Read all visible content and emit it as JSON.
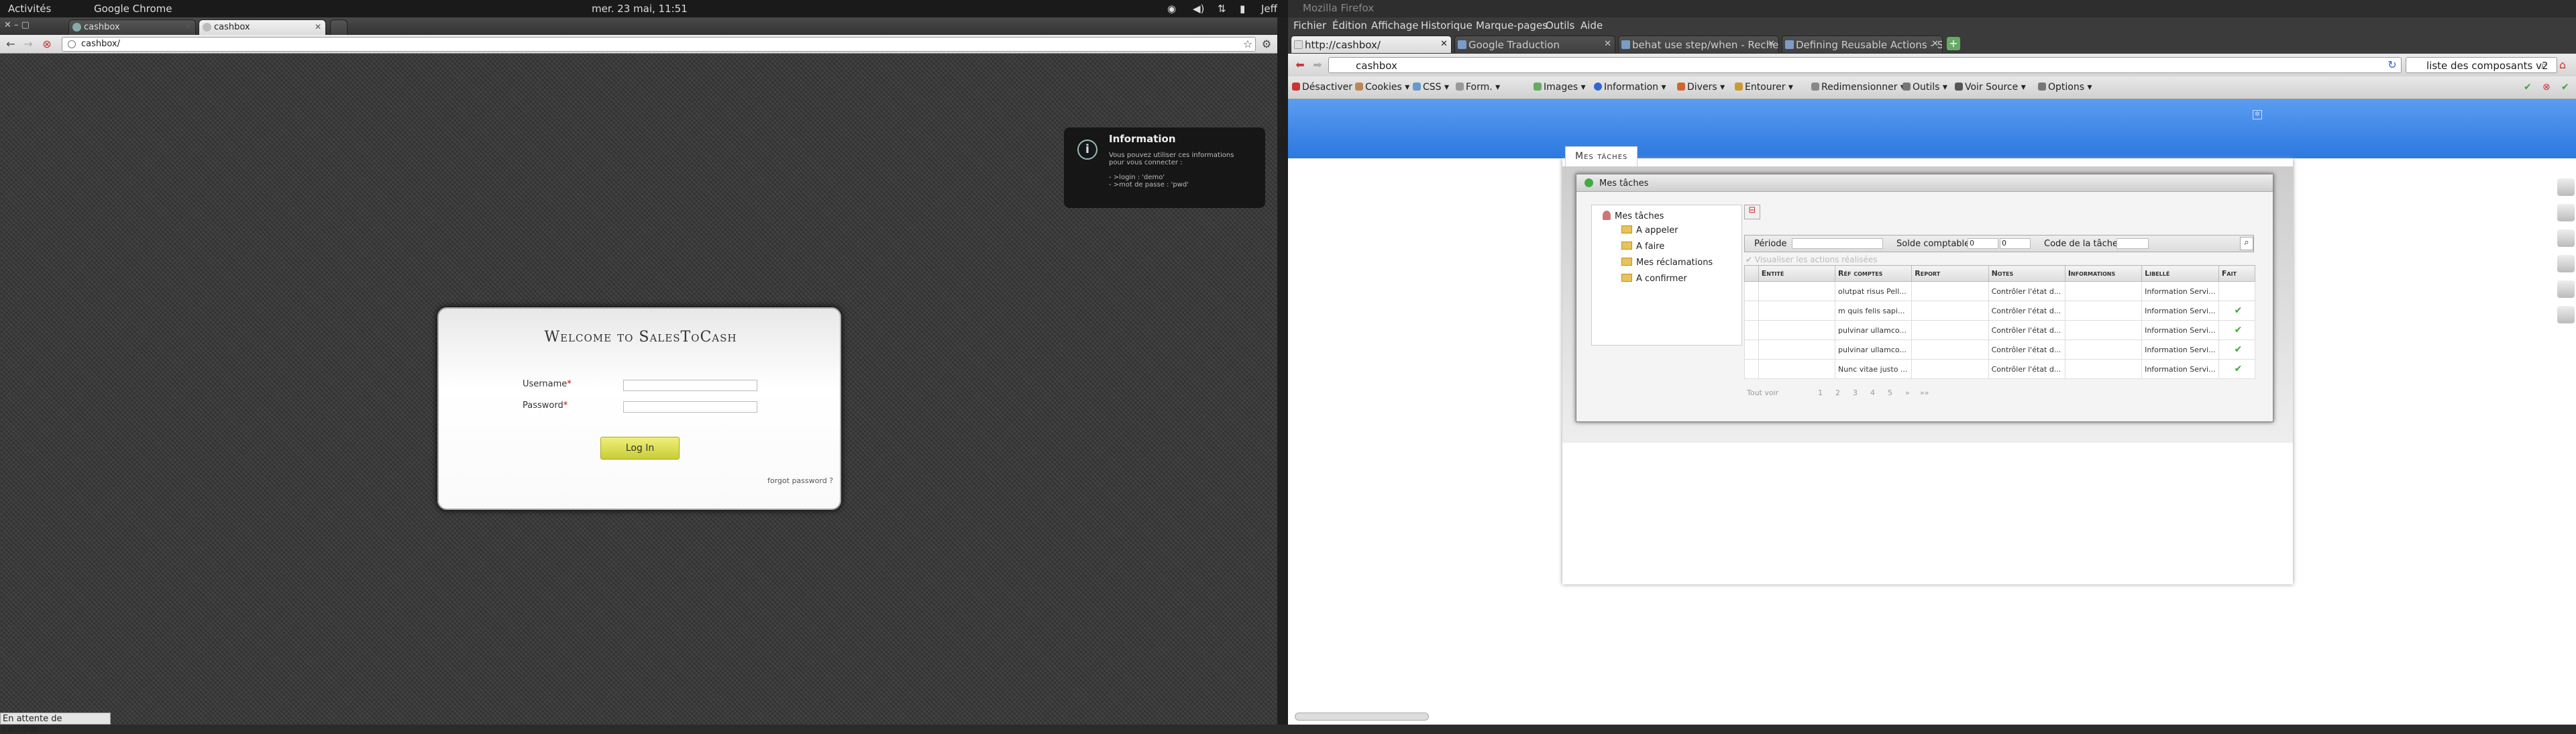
{
  "topbar": {
    "activities": "Activités",
    "app": "Google Chrome",
    "clock": "mer. 23 mai, 11:51",
    "user": "Jeff"
  },
  "chrome": {
    "tabs": [
      {
        "label": "cashbox"
      },
      {
        "label": "cashbox"
      }
    ],
    "url": "cashbox/",
    "status": "En attente de cashbox...",
    "info": {
      "title": "Information",
      "lines": [
        "Vous pouvez utiliser ces informations",
        "pour vous connecter :",
        "",
        "- >login : 'demo'",
        "- >mot de passe : 'pwd'"
      ]
    },
    "login": {
      "title": "Welcome to SalesToCash",
      "username_label": "Username",
      "password_label": "Password",
      "required_mark": "*",
      "button": "Log In",
      "forgot": "forgot password ?"
    }
  },
  "firefox": {
    "title": "Mozilla Firefox",
    "menu": [
      "Fichier",
      "Édition",
      "Affichage",
      "Historique",
      "Marque-pages",
      "Outils",
      "Aide"
    ],
    "tabs": [
      {
        "label": "http://cashbox/"
      },
      {
        "label": "Google Traduction"
      },
      {
        "label": "behat use step/when - Reche..."
      },
      {
        "label": "Defining Reusable Actions - S..."
      }
    ],
    "url": "cashbox",
    "search": "liste des composants v2",
    "webdev": [
      "Désactiver",
      "Cookies",
      "CSS",
      "Form.",
      "Images",
      "Information",
      "Divers",
      "Entourer",
      "Redimensionner",
      "Outils",
      "Voir Source",
      "Options"
    ],
    "app": {
      "tab": "Mes tâches",
      "panel_title": "Mes tâches",
      "tree": {
        "root": "Mes tâches",
        "items": [
          "A appeler",
          "A faire",
          "Mes réclamations",
          "A confirmer"
        ]
      },
      "filters": {
        "periode": "Période",
        "solde": "Solde comptable",
        "solde_from": "0",
        "solde_to": "0",
        "code": "Code de la tâche"
      },
      "show_done": "Visualiser les actions réalisées",
      "columns": [
        "Entité",
        "Réf comptes",
        "Report",
        "Notes",
        "Informations",
        "Libellé",
        "Fait"
      ],
      "rows": [
        [
          "",
          "olutpat risus Pell...",
          "",
          "Contrôler l'état d...",
          "",
          "Information Servi...",
          ""
        ],
        [
          "",
          "m quis felis sapi...",
          "",
          "Contrôler l'état d...",
          "",
          "Information Servi...",
          "✔"
        ],
        [
          "",
          "pulvinar ullamco...",
          "",
          "Contrôler l'état d...",
          "",
          "Information Servi...",
          "✔"
        ],
        [
          "",
          "pulvinar ullamco...",
          "",
          "Contrôler l'état d...",
          "",
          "Information Servi...",
          "✔"
        ],
        [
          "",
          "Nunc vitae justo ...",
          "",
          "Contrôler l'état d...",
          "",
          "Information Servi...",
          "✔"
        ]
      ],
      "pager": {
        "all": "Tout voir",
        "pages": [
          "1",
          "2",
          "3",
          "4",
          "5",
          "»",
          "»»"
        ]
      }
    }
  }
}
